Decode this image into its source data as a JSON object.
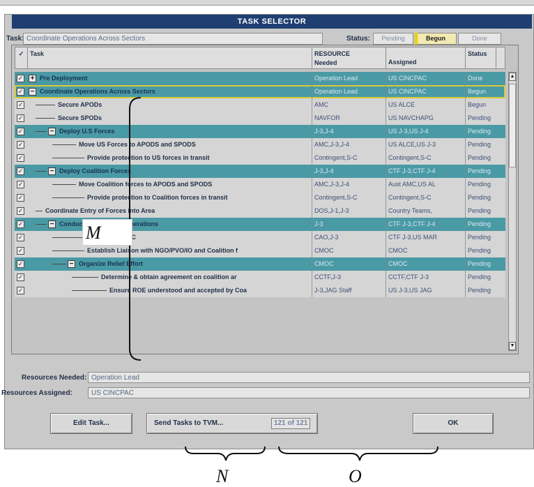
{
  "window": {
    "title": "TASK SELECTOR"
  },
  "task_field": {
    "label": "Task:",
    "value": "Coordinate Operations Across Sectors"
  },
  "status_field": {
    "label": "Status:",
    "options": [
      "Pending",
      "Begun",
      "Done"
    ],
    "selected": "Begun"
  },
  "table": {
    "headers": {
      "check": "✓",
      "task": "Task",
      "resource_line1": "RESOURCE",
      "resource_line2": "Needed",
      "assigned": "Assigned",
      "status": "Status"
    },
    "rows": [
      {
        "name": "Pre Deployment",
        "resource": "Operation Lead",
        "assigned": "US CINCPAC",
        "status": "Done"
      },
      {
        "name": "Coordinate Operations Across Sectors",
        "resource": "Operation Lead",
        "assigned": "US CINCPAC",
        "status": "Begun"
      },
      {
        "name": "Secure APODs",
        "resource": "AMC",
        "assigned": "US ALCE",
        "status": "Begun"
      },
      {
        "name": "Secure SPODs",
        "resource": "NAVFOR",
        "assigned": "US NAVCHAPG",
        "status": "Pending"
      },
      {
        "name": "Deploy U.S Forces",
        "resource": "J-3,J-4",
        "assigned": "US J-3,US J-4",
        "status": "Pending"
      },
      {
        "name": "Move US Forces to APODS and SPODS",
        "resource": "AMC,J-3,J-4",
        "assigned": "US ALCE,US J-3",
        "status": "Pending"
      },
      {
        "name": "Provide protection to US forces in transit",
        "resource": "Contingent,S-C",
        "assigned": "Contingent,S-C",
        "status": "Pending"
      },
      {
        "name": "Deploy Coalition Forces",
        "resource": "J-3,J-4",
        "assigned": "CTF J-3,CTF J-4",
        "status": "Pending"
      },
      {
        "name": "Move Coalition forces to APODS and SPODS",
        "resource": "AMC,J-3,J-4",
        "assigned": "Aust AMC,US AL",
        "status": "Pending"
      },
      {
        "name": "Provide protection to Coalition forces in transit",
        "resource": "Contingent,S-C",
        "assigned": "Contingent,S-C",
        "status": "Pending"
      },
      {
        "name": "Coordinate Entry of Forces into Area",
        "resource": "DOS,J-1,J-3",
        "assigned": "Country Teams,",
        "status": "Pending"
      },
      {
        "name": "Conduct Civil Military Operations",
        "resource": "J-3",
        "assigned": "CTF J-3,CTF J-4",
        "status": "Pending"
      },
      {
        "name": "Establish CMOC",
        "resource": "CAO,J-3",
        "assigned": "CTF J-3,US MAR",
        "status": "Pending"
      },
      {
        "name": "Establish Liaison with NGO/PVO/IO and Coalition f",
        "resource": "CMOC",
        "assigned": "CMOC",
        "status": "Pending"
      },
      {
        "name": "Organize Relief Effort",
        "resource": "CMOC",
        "assigned": "CMOC",
        "status": "Pending"
      },
      {
        "name": "Determine & obtain agreement on coalition ar",
        "resource": "CCTF,J-3",
        "assigned": "CCTF,CTF J-3",
        "status": "Pending"
      },
      {
        "name": "Ensure ROE understood and accepted by Coa",
        "resource": "J-3,JAG Staff",
        "assigned": "US J-3,US JAG",
        "status": "Pending"
      }
    ]
  },
  "resources_needed": {
    "label": "Resources Needed:",
    "value": "Operation Lead"
  },
  "resources_assigned": {
    "label": "Resources Assigned:",
    "value": "US CINCPAC"
  },
  "buttons": {
    "edit": "Edit Task...",
    "send": "Send Tasks to TVM...",
    "counter": "121 of 121",
    "ok": "OK"
  },
  "annotations": {
    "m": "M",
    "n": "N",
    "o": "O"
  }
}
